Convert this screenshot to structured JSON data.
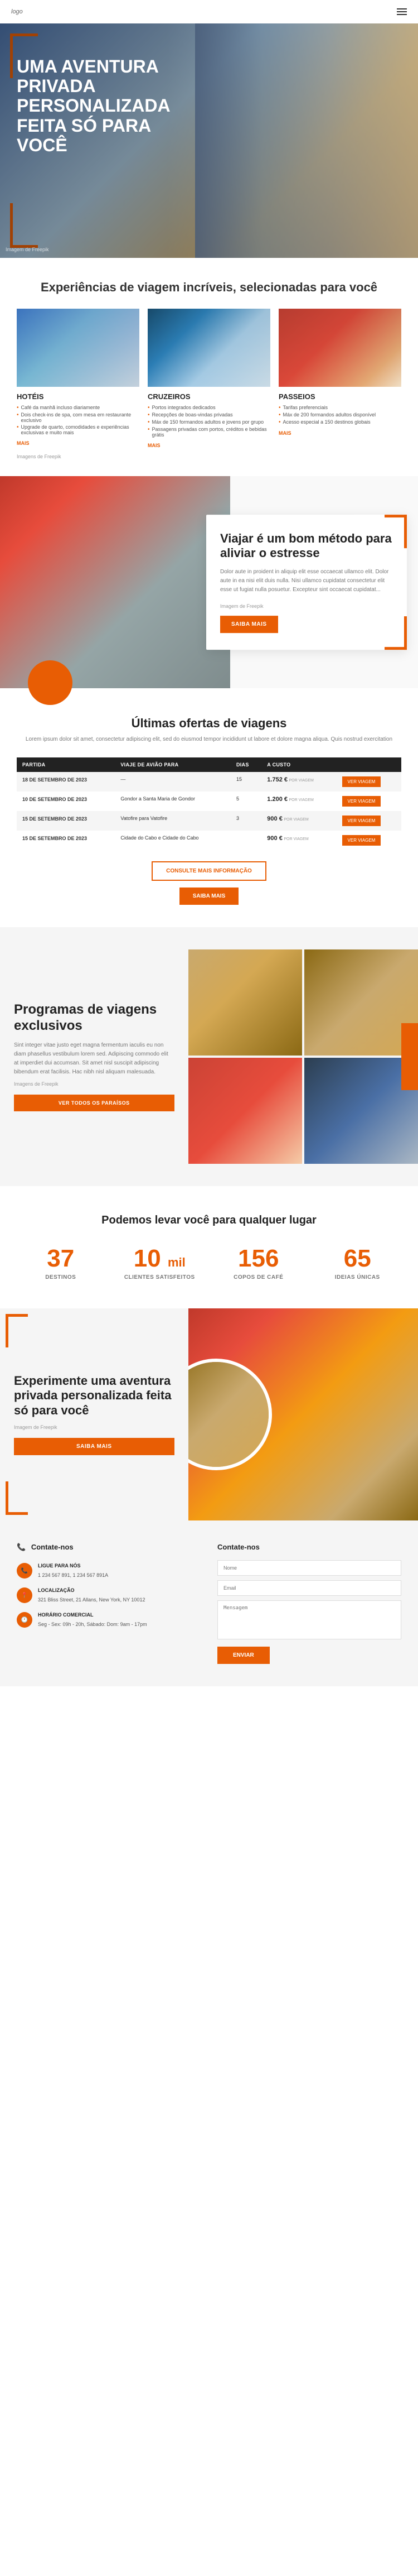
{
  "nav": {
    "logo": "logo",
    "menu_icon": "☰"
  },
  "hero": {
    "title": "UMA AVENTURA PRIVADA PERSONALIZADA FEITA SÓ PARA VOCÊ",
    "img_label": "Imagem de Freepik"
  },
  "experiences": {
    "heading": "Experiências de viagem incríveis, selecionadas para você",
    "img_label": "Imagens de Freepik",
    "cards": [
      {
        "title": "HOTÉIS",
        "items": [
          "Café da manhã incluso diariamente",
          "Dois check-ins de spa, com mesa em restaurante exclusivo",
          "Upgrade de quarto, comodidades e experiências exclusivas e muito mais"
        ],
        "more": "MAIS"
      },
      {
        "title": "CRUZEIROS",
        "items": [
          "Portos integrados dedicados",
          "Recepções de boas-vindas privadas",
          "Máx de 150 formandos adultos e jovens por grupo",
          "Passagens privadas com portos, créditos e bebidas grátis"
        ],
        "more": "MAIS"
      },
      {
        "title": "PASSEIOS",
        "items": [
          "Tarifas preferenciais",
          "Máx de 200 formandos adultos disponível",
          "Acesso especial a 150 destinos globais"
        ],
        "more": "MAIS"
      }
    ]
  },
  "travel_method": {
    "heading": "Viajar é um bom método para aliviar o estresse",
    "body": "Dolor aute in proident in aliquip elit esse occaecat ullamco elit. Dolor aute in ea nisi elit duis nulla. Nisi ullamco cupidatat consectetur elit esse ut fugiat nulla posuetur. Excepteur sint occaecat cupidatat...",
    "img_label": "Imagem de Freepik",
    "cta": "SAIBA MAIS"
  },
  "offers": {
    "heading": "Últimas ofertas de viagens",
    "subtitle": "Lorem ipsum dolor sit amet, consectetur adipiscing elit, sed do eiusmod tempor incididunt ut labore et dolore magna aliqua. Quis nostrud exercitation",
    "columns": [
      "PARTIDA",
      "VIAJE DE AVIÃO PARA",
      "DIAS",
      "A CUSTO",
      ""
    ],
    "rows": [
      {
        "date": "18 DE SETEMBRO DE 2023",
        "destination": "—",
        "days": "15",
        "price": "1.752 €",
        "price_label": "POR VIAGEM",
        "action": "VER VIAGEM"
      },
      {
        "date": "10 DE SETEMBRO DE 2023",
        "destination": "Gondor a Santa Maria de Gondor",
        "days": "5",
        "price": "1.200 €",
        "price_label": "POR VIAGEM",
        "action": "VER VIAGEM"
      },
      {
        "date": "15 DE SETEMBRO DE 2023",
        "destination": "Vatofire para Vatofire",
        "days": "3",
        "price": "900 €",
        "price_label": "POR VIAGEM",
        "action": "VER VIAGEM"
      },
      {
        "date": "15 DE SETEMBRO DE 2023",
        "destination": "Cidade do Cabo e Cidade do Cabo",
        "days": "",
        "price": "900 €",
        "price_label": "POR VIAGEM",
        "action": "VER VIAGEM"
      }
    ],
    "view_more": "CONSULTE MAIS INFORMAÇÃO",
    "saiba_mais": "SAIBA MAIS"
  },
  "programs": {
    "heading": "Programas de viagens exclusivos",
    "body": "Sint integer vitae justo eget magna fermentum iaculis eu non diam phasellus vestibulum lorem sed. Adipiscing commodo elit at imperdiet dui accumsan. Sit amet nisl suscipit adipiscing bibendum erat facilisis. Hac nibh nisl aliquam malesuada.",
    "img_label": "Imagens de Freepik",
    "cta": "VER TODOS OS PARAÍSOS"
  },
  "stats": {
    "heading": "Podemos levar você para qualquer lugar",
    "items": [
      {
        "number": "37",
        "label": "DESTINOS"
      },
      {
        "number": "10",
        "suffix": "mil",
        "label": "CLIENTES SATISFEITOS"
      },
      {
        "number": "156",
        "label": "COPOS DE CAFÉ"
      },
      {
        "number": "65",
        "label": "IDEIAS ÚNICAS"
      }
    ]
  },
  "private": {
    "heading": "Experimente uma aventura privada personalizada feita só para você",
    "img_label": "Imagem de Freepik",
    "cta": "SAIBA MAIS"
  },
  "contact": {
    "info_heading": "Contate-nos",
    "form_heading": "Contate-nos",
    "items": [
      {
        "icon": "📞",
        "label": "LIGUE PARA NÓS",
        "value": "1 234 567 891, 1 234 567 891A"
      },
      {
        "icon": "📍",
        "label": "LOCALIZAÇÃO",
        "value": "321 Bliss Street, 21 Allans, New York, NY 10012"
      },
      {
        "icon": "🕐",
        "label": "HORÁRIO COMERCIAL",
        "value": "Seg - Sex: 09h - 20h, Sábado: Dom: 9am - 17pm"
      }
    ],
    "form": {
      "name_placeholder": "Nome",
      "email_placeholder": "Email",
      "message_placeholder": "Mensagem",
      "submit": "Enviar"
    }
  }
}
